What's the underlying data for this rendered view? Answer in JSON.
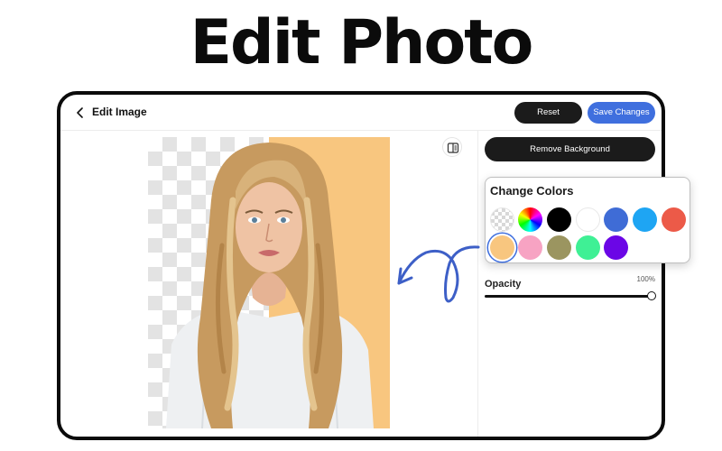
{
  "hero": {
    "title": "Edit Photo"
  },
  "header": {
    "title": "Edit Image",
    "reset_label": "Reset",
    "save_label": "Save Changes"
  },
  "sidebar": {
    "remove_bg_label": "Remove Background",
    "opacity": {
      "label": "Opacity",
      "value_text": "100%",
      "value": 1.0
    }
  },
  "colors": {
    "title": "Change Colors",
    "swatches": [
      {
        "name": "transparent"
      },
      {
        "name": "custom-spectrum"
      },
      {
        "name": "black",
        "hex": "#000000"
      },
      {
        "name": "white",
        "hex": "#ffffff"
      },
      {
        "name": "royal-blue",
        "hex": "#3f6cd6"
      },
      {
        "name": "sky-blue",
        "hex": "#1ea5f3"
      },
      {
        "name": "coral-red",
        "hex": "#ec5a48"
      },
      {
        "name": "peach",
        "hex": "#f8c67f",
        "selected": true
      },
      {
        "name": "pink",
        "hex": "#f7a3c3"
      },
      {
        "name": "olive",
        "hex": "#9b9560"
      },
      {
        "name": "mint",
        "hex": "#3ff095"
      },
      {
        "name": "violet",
        "hex": "#6b06e6"
      }
    ]
  },
  "canvas": {
    "background_color": "#f8c67f"
  },
  "theme": {
    "accent": "#3f6fde",
    "dark": "#1b1b1b"
  }
}
